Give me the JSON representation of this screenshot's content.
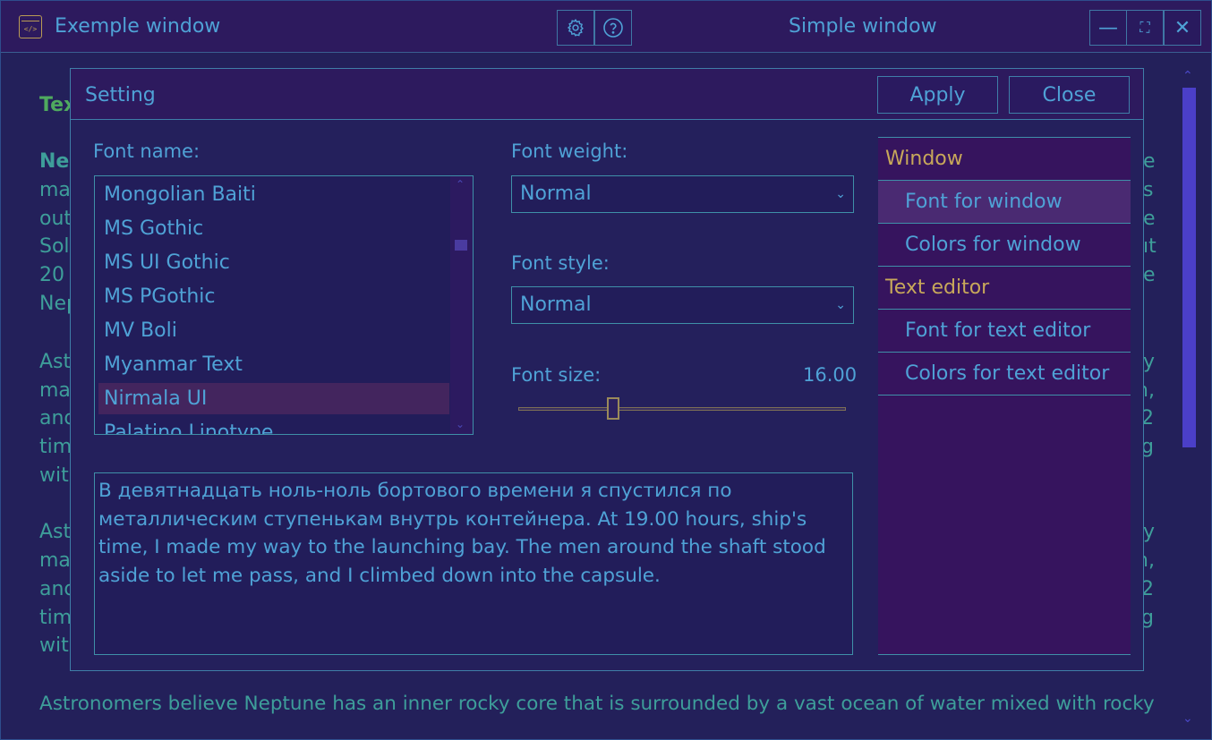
{
  "window": {
    "title": "Exemple window",
    "center_title": "Simple window",
    "settings_icon": "gear-icon",
    "help_icon": "question-icon",
    "minimize_label": "—",
    "maximize_label": "⛶",
    "close_label": "✕"
  },
  "page": {
    "heading_partial": "Tex",
    "para1_bold_partial": "Nep",
    "para1_left": [
      "ma",
      "out",
      "Sol",
      "20",
      "Nep"
    ],
    "para1_right": [
      "e",
      "s",
      "e",
      "ıt",
      "e"
    ],
    "para2_left": [
      "Ast",
      "ma",
      "and",
      "tim",
      "wit"
    ],
    "para2_right": [
      "y",
      "n,",
      "2",
      "g",
      ""
    ],
    "para3_left": [
      "Ast",
      "ma",
      "and",
      "tim",
      "wit"
    ],
    "para3_right": [
      "y",
      "n,",
      "2",
      "g",
      ""
    ],
    "bottom_line": "Astronomers believe Neptune has an inner rocky core that is surrounded by a vast ocean of water mixed with rocky"
  },
  "dialog": {
    "title": "Setting",
    "apply_label": "Apply",
    "close_label": "Close",
    "font_name_label": "Font name:",
    "font_list": [
      "Mongolian Baiti",
      "MS Gothic",
      "MS UI Gothic",
      "MS PGothic",
      "MV Boli",
      "Myanmar Text",
      "Nirmala UI",
      "Palatino Linotype"
    ],
    "selected_font": "Nirmala UI",
    "font_weight_label": "Font weight:",
    "font_weight_value": "Normal",
    "font_style_label": "Font style:",
    "font_style_value": "Normal",
    "font_size_label": "Font size:",
    "font_size_value": "16.00",
    "font_size_fraction": 0.29,
    "preview_text": "В девятнадцать ноль-ноль бортового времени я спустился по металлическим ступенькам внутрь контейнера. At 19.00 hours, ship's time, I made my way to the launching bay. The men around the shaft stood aside to let me pass, and I climbed down into the capsule.",
    "nav": {
      "window_section": "Window",
      "font_for_window": "Font for window",
      "colors_for_window": "Colors for window",
      "text_editor_section": "Text editor",
      "font_for_text_editor": "Font for text editor",
      "colors_for_text_editor": "Colors for text editor"
    }
  },
  "colors": {
    "accent_text": "#4fa2d6",
    "section_text": "#c8a85a",
    "heading_green": "#4faa5f"
  }
}
